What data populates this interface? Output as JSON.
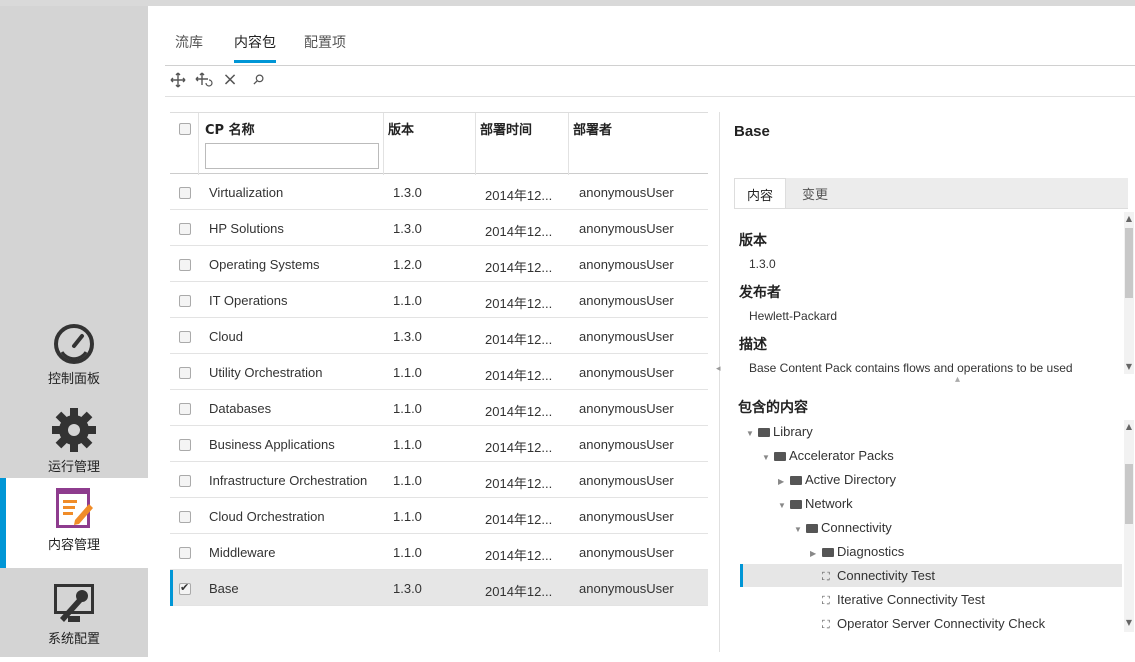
{
  "nav": {
    "items": [
      {
        "label": "控制面板",
        "icon": "dashboard-gauge-icon"
      },
      {
        "label": "运行管理",
        "icon": "gear-icon"
      },
      {
        "label": "内容管理",
        "icon": "content-edit-icon"
      },
      {
        "label": "系统配置",
        "icon": "tools-icon"
      }
    ],
    "active_color": "#0096d6"
  },
  "tabs": [
    {
      "label": "流库"
    },
    {
      "label": "内容包"
    },
    {
      "label": "配置项"
    }
  ],
  "toolbar": {
    "icons": [
      "deploy-icon",
      "redeploy-icon",
      "delete-icon",
      "filter-clear-icon"
    ],
    "delete_glyph": "×",
    "filter_glyph": "⚲"
  },
  "table": {
    "headers": {
      "name": "CP 名称",
      "version": "版本",
      "time": "部署时间",
      "deployer": "部署者"
    },
    "rows": [
      {
        "name": "Virtualization",
        "version": "1.3.0",
        "time": "2014年12...",
        "deployer": "anonymousUser"
      },
      {
        "name": "HP Solutions",
        "version": "1.3.0",
        "time": "2014年12...",
        "deployer": "anonymousUser"
      },
      {
        "name": "Operating Systems",
        "version": "1.2.0",
        "time": "2014年12...",
        "deployer": "anonymousUser"
      },
      {
        "name": "IT Operations",
        "version": "1.1.0",
        "time": "2014年12...",
        "deployer": "anonymousUser"
      },
      {
        "name": "Cloud",
        "version": "1.3.0",
        "time": "2014年12...",
        "deployer": "anonymousUser"
      },
      {
        "name": "Utility Orchestration",
        "version": "1.1.0",
        "time": "2014年12...",
        "deployer": "anonymousUser"
      },
      {
        "name": "Databases",
        "version": "1.1.0",
        "time": "2014年12...",
        "deployer": "anonymousUser"
      },
      {
        "name": "Business Applications",
        "version": "1.1.0",
        "time": "2014年12...",
        "deployer": "anonymousUser"
      },
      {
        "name": "Infrastructure Orchestration",
        "version": "1.1.0",
        "time": "2014年12...",
        "deployer": "anonymousUser"
      },
      {
        "name": "Cloud Orchestration",
        "version": "1.1.0",
        "time": "2014年12...",
        "deployer": "anonymousUser"
      },
      {
        "name": "Middleware",
        "version": "1.1.0",
        "time": "2014年12...",
        "deployer": "anonymousUser"
      },
      {
        "name": "Base",
        "version": "1.3.0",
        "time": "2014年12...",
        "deployer": "anonymousUser"
      }
    ]
  },
  "detail": {
    "title": "Base",
    "tabs": [
      {
        "label": "内容"
      },
      {
        "label": "变更"
      }
    ],
    "version_label": "版本",
    "version": "1.3.0",
    "publisher_label": "发布者",
    "publisher": "Hewlett-Packard",
    "description_label": "描述",
    "description": "Base Content Pack contains flows and operations to be used",
    "contents_label": "包含的内容",
    "tree": [
      {
        "label": "Library",
        "type": "folder",
        "expanded": true
      },
      {
        "label": "Accelerator Packs",
        "type": "folder",
        "expanded": true
      },
      {
        "label": "Active Directory",
        "type": "folder",
        "expanded": false
      },
      {
        "label": "Network",
        "type": "folder",
        "expanded": true
      },
      {
        "label": "Connectivity",
        "type": "folder",
        "expanded": true
      },
      {
        "label": "Diagnostics",
        "type": "folder",
        "expanded": false
      },
      {
        "label": "Connectivity Test",
        "type": "flow",
        "selected": true
      },
      {
        "label": "Iterative Connectivity Test",
        "type": "flow"
      },
      {
        "label": "Operator Server Connectivity Check",
        "type": "flow"
      }
    ]
  }
}
